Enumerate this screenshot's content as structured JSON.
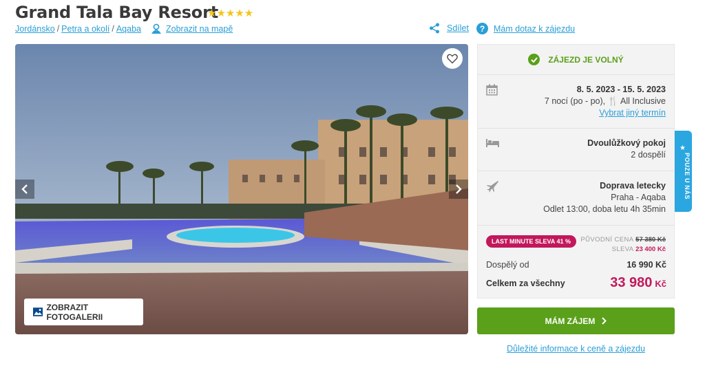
{
  "header": {
    "title": "Grand Tala Bay Resort",
    "stars": "★★★★★",
    "breadcrumb": [
      "Jordánsko",
      "Petra a okolí",
      "Aqaba"
    ],
    "map_link": "Zobrazit na mapě",
    "share_label": "Sdílet",
    "ask_label": "Mám dotaz k zájezdu"
  },
  "gallery": {
    "button_label": "ZOBRAZIT FOTOGALERII"
  },
  "booking": {
    "availability": "ZÁJEZD JE VOLNÝ",
    "dates": "8. 5. 2023 - 15. 5. 2023",
    "nights": "7 nocí (po - po),",
    "board": "All Inclusive",
    "change_term": "Vybrat jiný termín",
    "room_type": "Dvoulůžkový pokoj",
    "room_guests": "2 dospělí",
    "transport": "Doprava letecky",
    "route": "Praha - Aqaba",
    "departure": "Odlet 13:00, doba letu 4h 35min",
    "discount_badge": "LAST MINUTE SLEVA 41 %",
    "original_price_label": "PŮVODNÍ CENA",
    "original_price": "57 380 Kč",
    "discount_label": "SLEVA",
    "discount_value": "23 400 Kč",
    "adult_label": "Dospělý od",
    "adult_price": "16 990 Kč",
    "total_label": "Celkem za všechny",
    "total_price": "33 980",
    "total_currency": "Kč",
    "cta_label": "MÁM ZÁJEM",
    "info_link": "Důležité informace k ceně a zájezdu"
  },
  "side_tab": {
    "label": "POUZE U NÁS"
  },
  "colors": {
    "accent_blue": "#2a9fd6",
    "cta_green": "#5aa01a",
    "price_magenta": "#c2185b",
    "star_gold": "#f5c518"
  }
}
